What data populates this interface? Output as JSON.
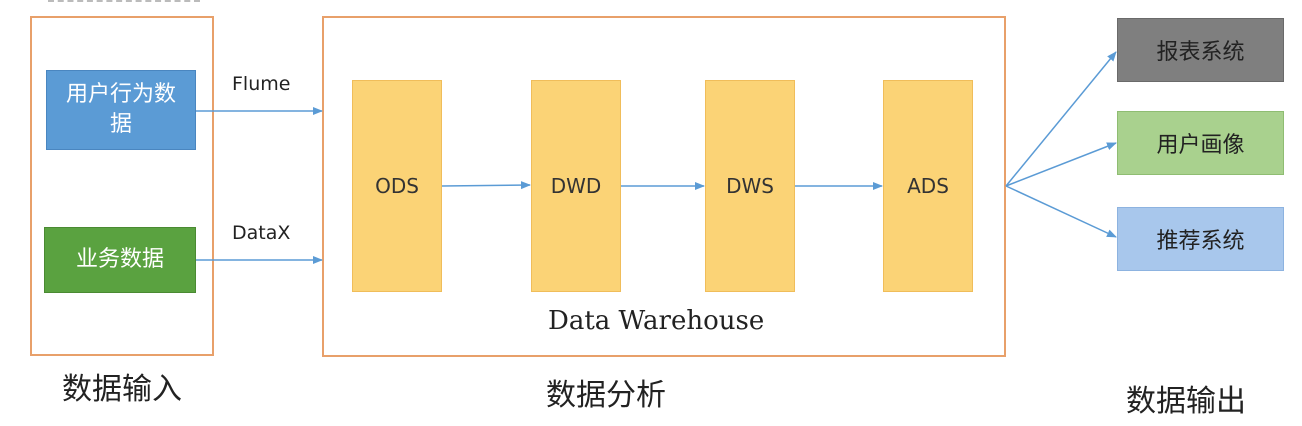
{
  "inputs": {
    "title": "数据输入",
    "behavior_data": "用户行为数据",
    "business_data": "业务数据"
  },
  "edges": {
    "flume": "Flume",
    "datax": "DataX"
  },
  "warehouse": {
    "caption": "Data Warehouse",
    "title": "数据分析",
    "layers": [
      "ODS",
      "DWD",
      "DWS",
      "ADS"
    ]
  },
  "outputs": {
    "title": "数据输出",
    "items": [
      "报表系统",
      "用户画像",
      "推荐系统"
    ]
  },
  "colors": {
    "frame": "#e8a06a",
    "behavior_box": "#5b9bd5",
    "business_box": "#5aa240",
    "layer": "#fbd376",
    "report_box": "#7f7f7f",
    "profile_box": "#a9d18e",
    "recommend_box": "#a8c7ec",
    "arrow": "#5b9bd5"
  }
}
